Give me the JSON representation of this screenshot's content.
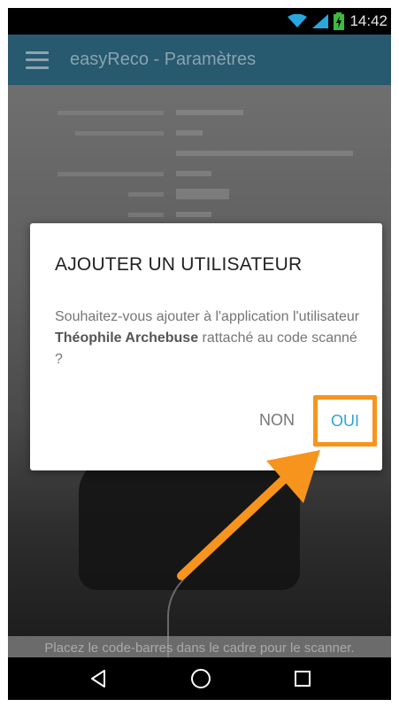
{
  "status_bar": {
    "time": "14:42"
  },
  "app_bar": {
    "title": "easyReco - Paramètres"
  },
  "camera_hint": "Placez le code-barres dans le cadre pour le scanner.",
  "dialog": {
    "title": "AJOUTER UN UTILISATEUR",
    "message_part1": "Souhaitez-vous ajouter à l'application l'utilisateur ",
    "message_user": "Théophile Archebuse",
    "message_part2": " rattaché au code scanné ?",
    "no_label": "NON",
    "yes_label": "OUI"
  },
  "icons": {
    "status": [
      "wifi-icon",
      "signal-icon",
      "battery-charging-icon"
    ],
    "nav": [
      "back-icon",
      "home-icon",
      "recents-icon"
    ],
    "menu": "hamburger-menu-icon"
  },
  "colors": {
    "app_bar": "#27596f",
    "accent_button": "#2ea3d8",
    "highlight": "#f7941d"
  }
}
